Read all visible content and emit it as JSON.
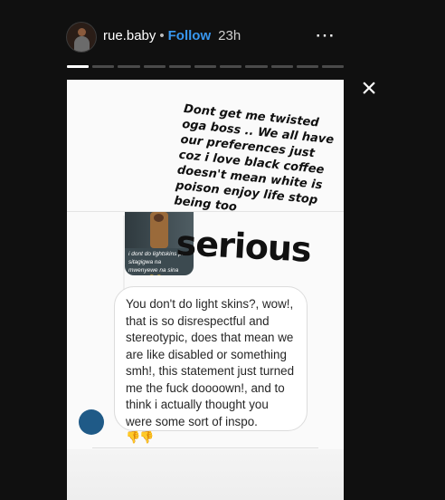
{
  "header": {
    "username": "rue.baby",
    "separator": "•",
    "follow_label": "Follow",
    "time_ago": "23h",
    "more_icon": "⋯"
  },
  "close_icon": "×",
  "caption": {
    "text": "Dont get me twisted oga boss .. We all have our preferences just coz i love black coffee doesn't mean white is poison enjoy life stop being too",
    "big_word": "serious"
  },
  "thumbnail": {
    "caption": "i dont do lightskins plus sitagigwa na mwenyewe na sina uwezo 😂😂"
  },
  "message": {
    "text": "You don't do light skins?, wow!, that is so disrespectful and stereotypic, does that mean we are like disabled or something smh!, this statement just turned me the fuck doooown!, and to think i actually thought you were some sort of inspo.",
    "emojis": "👎👎"
  },
  "progress": {
    "segments": 11,
    "active_index": 0
  }
}
